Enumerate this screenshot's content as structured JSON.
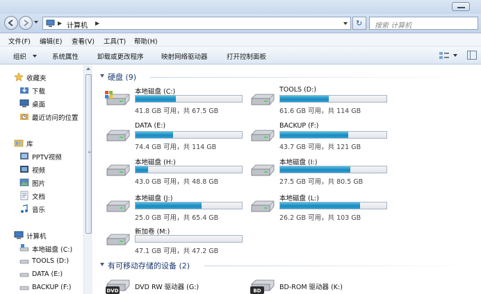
{
  "address": {
    "crumb": "计算机",
    "search_placeholder": "搜索 计算机"
  },
  "menu": [
    "文件(F)",
    "编辑(E)",
    "查看(V)",
    "工具(T)",
    "帮助(H)"
  ],
  "toolbar": [
    "组织",
    "系统属性",
    "卸载或更改程序",
    "映射网络驱动器",
    "打开控制面板"
  ],
  "nav": {
    "favorites": "收藏夹",
    "fav_items": [
      "下载",
      "桌面",
      "最近访问的位置"
    ],
    "libraries": "库",
    "lib_items": [
      "PPTV视频",
      "视频",
      "图片",
      "文档",
      "音乐"
    ],
    "computer": "计算机",
    "comp_items": [
      "本地磁盘 (C:)",
      "TOOLS (D:)",
      "DATA (E:)",
      "BACKUP (F:)"
    ]
  },
  "groups": {
    "hdd": "硬盘 (9)",
    "removable": "有可移动存储的设备 (2)"
  },
  "drives": [
    {
      "name": "本地磁盘 (C:)",
      "free_text": "41.8 GB 可用，共 67.5 GB",
      "used_fraction": 0.38,
      "system": true
    },
    {
      "name": "TOOLS (D:)",
      "free_text": "61.6 GB 可用，共 114 GB",
      "used_fraction": 0.46
    },
    {
      "name": "DATA (E:)",
      "free_text": "74.4 GB 可用，共 114 GB",
      "used_fraction": 0.35
    },
    {
      "name": "BACKUP (F:)",
      "free_text": "43.7 GB 可用，共 121 GB",
      "used_fraction": 0.64
    },
    {
      "name": "本地磁盘 (H:)",
      "free_text": "43.0 GB 可用，共 48.8 GB",
      "used_fraction": 0.12
    },
    {
      "name": "本地磁盘 (I:)",
      "free_text": "27.5 GB 可用，共 80.5 GB",
      "used_fraction": 0.66
    },
    {
      "name": "本地磁盘 (J:)",
      "free_text": "25.0 GB 可用，共 65.4 GB",
      "used_fraction": 0.62
    },
    {
      "name": "本地磁盘 (L:)",
      "free_text": "26.2 GB 可用，共 103 GB",
      "used_fraction": 0.75
    },
    {
      "name": "新加卷 (M:)",
      "free_text": "47.1 GB 可用，共 47.2 GB",
      "used_fraction": 0.0
    }
  ],
  "optical": [
    {
      "name": "DVD RW 驱动器 (G:)",
      "label": "DVD"
    },
    {
      "name": "BD-ROM 驱动器 (K:)",
      "label": "BD"
    }
  ],
  "colors": {
    "accent": "#1f88bd",
    "group_heading": "#1e3a6e"
  }
}
